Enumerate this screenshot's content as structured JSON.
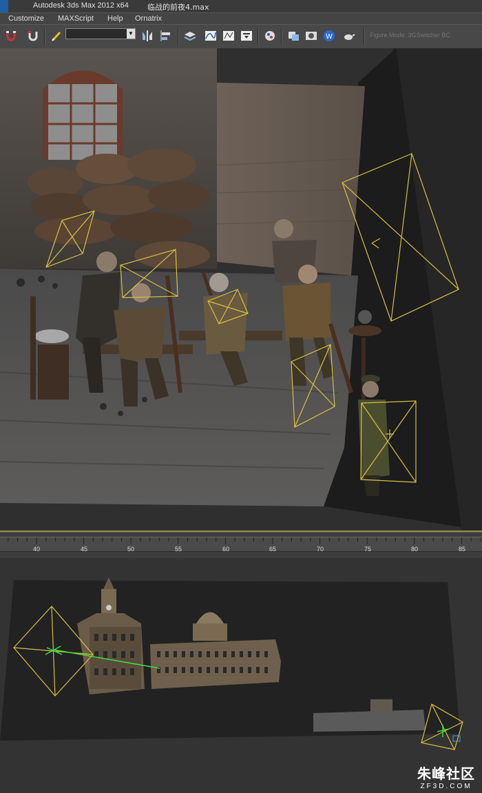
{
  "window": {
    "app_title": "Autodesk 3ds Max  2012 x64",
    "file_name": "临战的前夜4.max"
  },
  "menu": {
    "items": [
      "Customize",
      "MAXScript",
      "Help",
      "Ornatrix"
    ]
  },
  "toolbar": {
    "named_selection_value": "",
    "figure_mode_label": "Figure Mode: 3GSwitcher  BC",
    "icons": [
      "magnet-icon",
      "snap-toggle-icon",
      "edit-pencil-icon",
      "mirror-icon",
      "align-icon",
      "layer-manager-icon",
      "curve-editor-icon",
      "schematic-view-icon",
      "material-editor-icon",
      "render-setup-icon",
      "rendered-frame-icon",
      "render-production-icon",
      "render-teapot-icon"
    ]
  },
  "timeline": {
    "ticks": [
      "40",
      "45",
      "50",
      "55",
      "60",
      "65",
      "70",
      "75",
      "80",
      "85"
    ]
  },
  "watermark": {
    "name": "朱峰社区",
    "site": "ZF3D.COM"
  },
  "colors": {
    "camera_gizmo": "#d8c040",
    "target_line": "#40e040",
    "viewport_bg": "#2f2f2f",
    "active_border": "#a08a50"
  }
}
